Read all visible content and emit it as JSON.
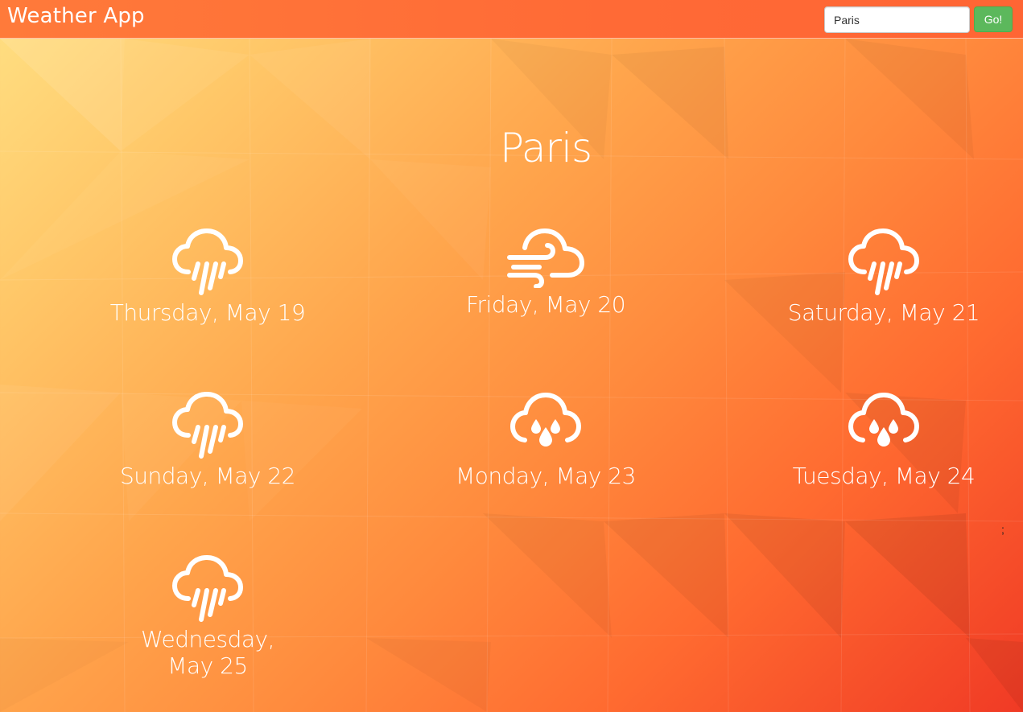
{
  "app": {
    "title": "Weather App"
  },
  "search": {
    "value": "Paris",
    "button_label": "Go!"
  },
  "city": "Paris",
  "forecast": [
    {
      "label": "Thursday, May 19",
      "icon": "rain-icon"
    },
    {
      "label": "Friday, May 20",
      "icon": "wind-cloud-icon"
    },
    {
      "label": "Saturday, May 21",
      "icon": "rain-icon"
    },
    {
      "label": "Sunday, May 22",
      "icon": "rain-icon"
    },
    {
      "label": "Monday, May 23",
      "icon": "showers-icon"
    },
    {
      "label": "Tuesday, May 24",
      "icon": "showers-icon"
    },
    {
      "label": "Wednesday, May 25",
      "icon": "rain-icon"
    }
  ],
  "stray_text": ";",
  "colors": {
    "navbar": "#ff6a36",
    "go_button": "#5cb85c",
    "text": "#ffffff"
  }
}
